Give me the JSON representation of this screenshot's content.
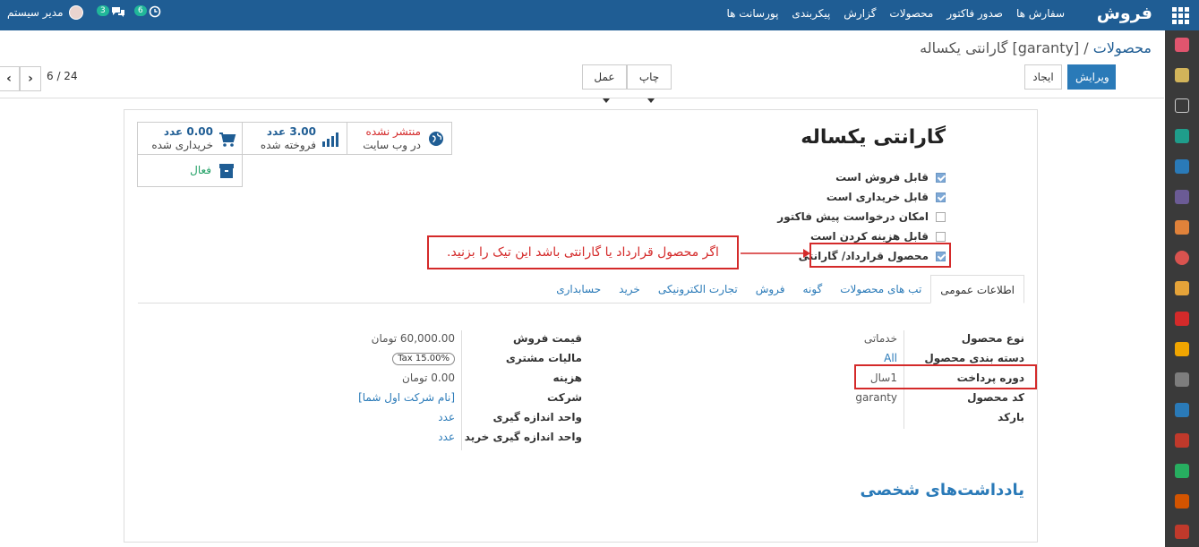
{
  "topbar": {
    "brand": "فروش",
    "menu": [
      "سفارش ها",
      "صدور فاکتور",
      "محصولات",
      "گزارش",
      "پیکربندی",
      "پورسانت ها"
    ],
    "user_name": "مدیر سیستم",
    "messages_count": "3",
    "activities_count": "6"
  },
  "control": {
    "breadcrumb_parent": "محصولات",
    "breadcrumb_sep": "/",
    "breadcrumb_current": "[garanty] گارانتی یکساله",
    "edit_label": "ویرایش",
    "create_label": "ایجاد",
    "print_label": "چاپ",
    "action_label": "عمل",
    "pager": "6 / 24"
  },
  "product": {
    "title": "گارانتی یکساله",
    "checkboxes": [
      {
        "label": "قابل فروش است",
        "checked": true
      },
      {
        "label": "قابل خریداری است",
        "checked": true
      },
      {
        "label": "امکان درخواست پیش فاکتور",
        "checked": false
      },
      {
        "label": "قابل هزینه کردن است",
        "checked": false
      },
      {
        "label": "محصول قرارداد/ گارانتی",
        "checked": true
      }
    ],
    "callout": "اگر محصول قرارداد یا گارانتی باشد این تیک را بزنید."
  },
  "stats": {
    "website_status": "منتشر نشده",
    "website_label": "در وب سایت",
    "sold_value": "3.00 عدد",
    "sold_label": "فروخته شده",
    "purchased_value": "0.00 عدد",
    "purchased_label": "خریداری شده",
    "active_label": "فعال"
  },
  "tabs": [
    "اطلاعات عمومی",
    "تب های محصولات",
    "گونه",
    "فروش",
    "تجارت الکترونیکی",
    "خرید",
    "حسابداری"
  ],
  "general": {
    "right": [
      {
        "label": "نوع محصول",
        "value": "خدماتی"
      },
      {
        "label": "دسته بندی محصول",
        "value": "All"
      },
      {
        "label": "دوره پرداخت",
        "value": "1سال"
      },
      {
        "label": "کد محصول",
        "value": "garanty"
      },
      {
        "label": "بارکد",
        "value": ""
      }
    ],
    "left": [
      {
        "label": "قیمت فروش",
        "value": "60,000.00 تومان"
      },
      {
        "label": "مالیات مشتری",
        "value": "Tax 15.00%"
      },
      {
        "label": "هزینه",
        "value": "0.00 تومان"
      },
      {
        "label": "شرکت",
        "value": "[نام شرکت اول شما]"
      },
      {
        "label": "واحد اندازه گیری",
        "value": "عدد"
      },
      {
        "label": "واحد اندازه گیری خرید",
        "value": "عدد"
      }
    ]
  },
  "notes_title": "یادداشت‌های شخصی",
  "colors": {
    "topbar": "#1f5d94",
    "primary": "#2a7ab8",
    "highlight": "#d42a2a",
    "sidebar": "#3a3a3a"
  }
}
